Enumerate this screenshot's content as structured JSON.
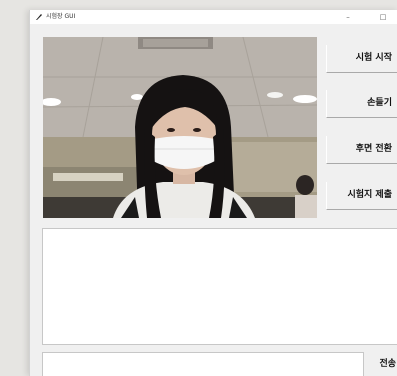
{
  "window": {
    "title": "시험장 GUI",
    "icon": "feather-icon",
    "minimize_symbol": "–",
    "maximize_symbol": "□"
  },
  "camera": {
    "icon": "webcam-feed"
  },
  "buttons": {
    "start_exam": "시험 시작",
    "raise_hand": "손들기",
    "flip_camera": "후면 전환",
    "submit_exam": "시험지 제출",
    "send": "전송"
  },
  "chat": {
    "log_text": "",
    "input_value": "",
    "input_placeholder": ""
  }
}
